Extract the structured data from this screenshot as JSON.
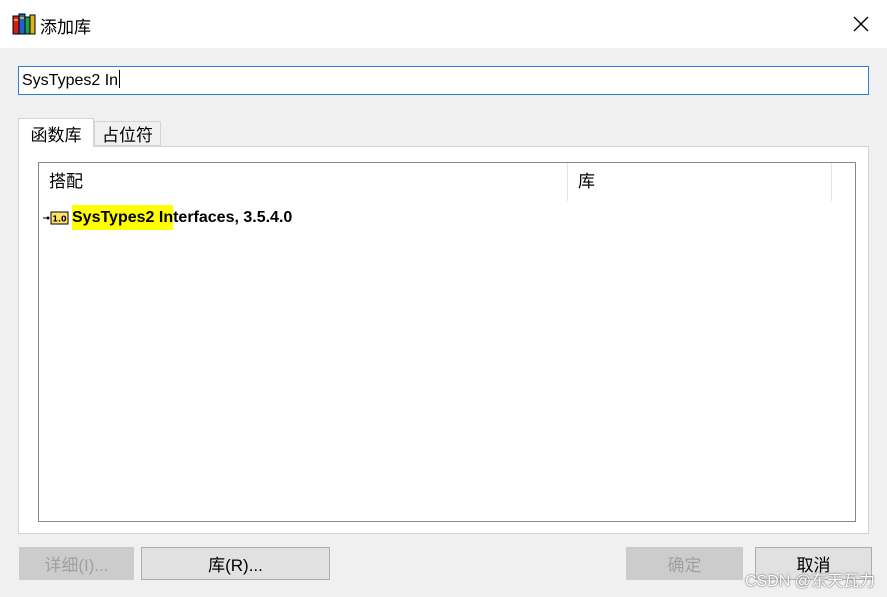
{
  "window": {
    "title": "添加库"
  },
  "search": {
    "value": "SysTypes2 In"
  },
  "tabs": [
    {
      "label": "函数库",
      "active": true
    },
    {
      "label": "占位符",
      "active": false
    }
  ],
  "list": {
    "columns": [
      "搭配",
      "库"
    ],
    "rows": [
      {
        "match_highlight": "SysTypes2 In",
        "rest": "terfaces, 3.5.4.0",
        "icon": "library-version-icon",
        "icon_text": "1.0"
      }
    ]
  },
  "buttons": {
    "details": "详细(I)...",
    "library": "库(R)...",
    "ok": "确定",
    "cancel": "取消"
  },
  "watermark": "CSDN @东天瓦力",
  "colors": {
    "highlight": "#ffff00",
    "focus_border": "#2a7fd6"
  }
}
